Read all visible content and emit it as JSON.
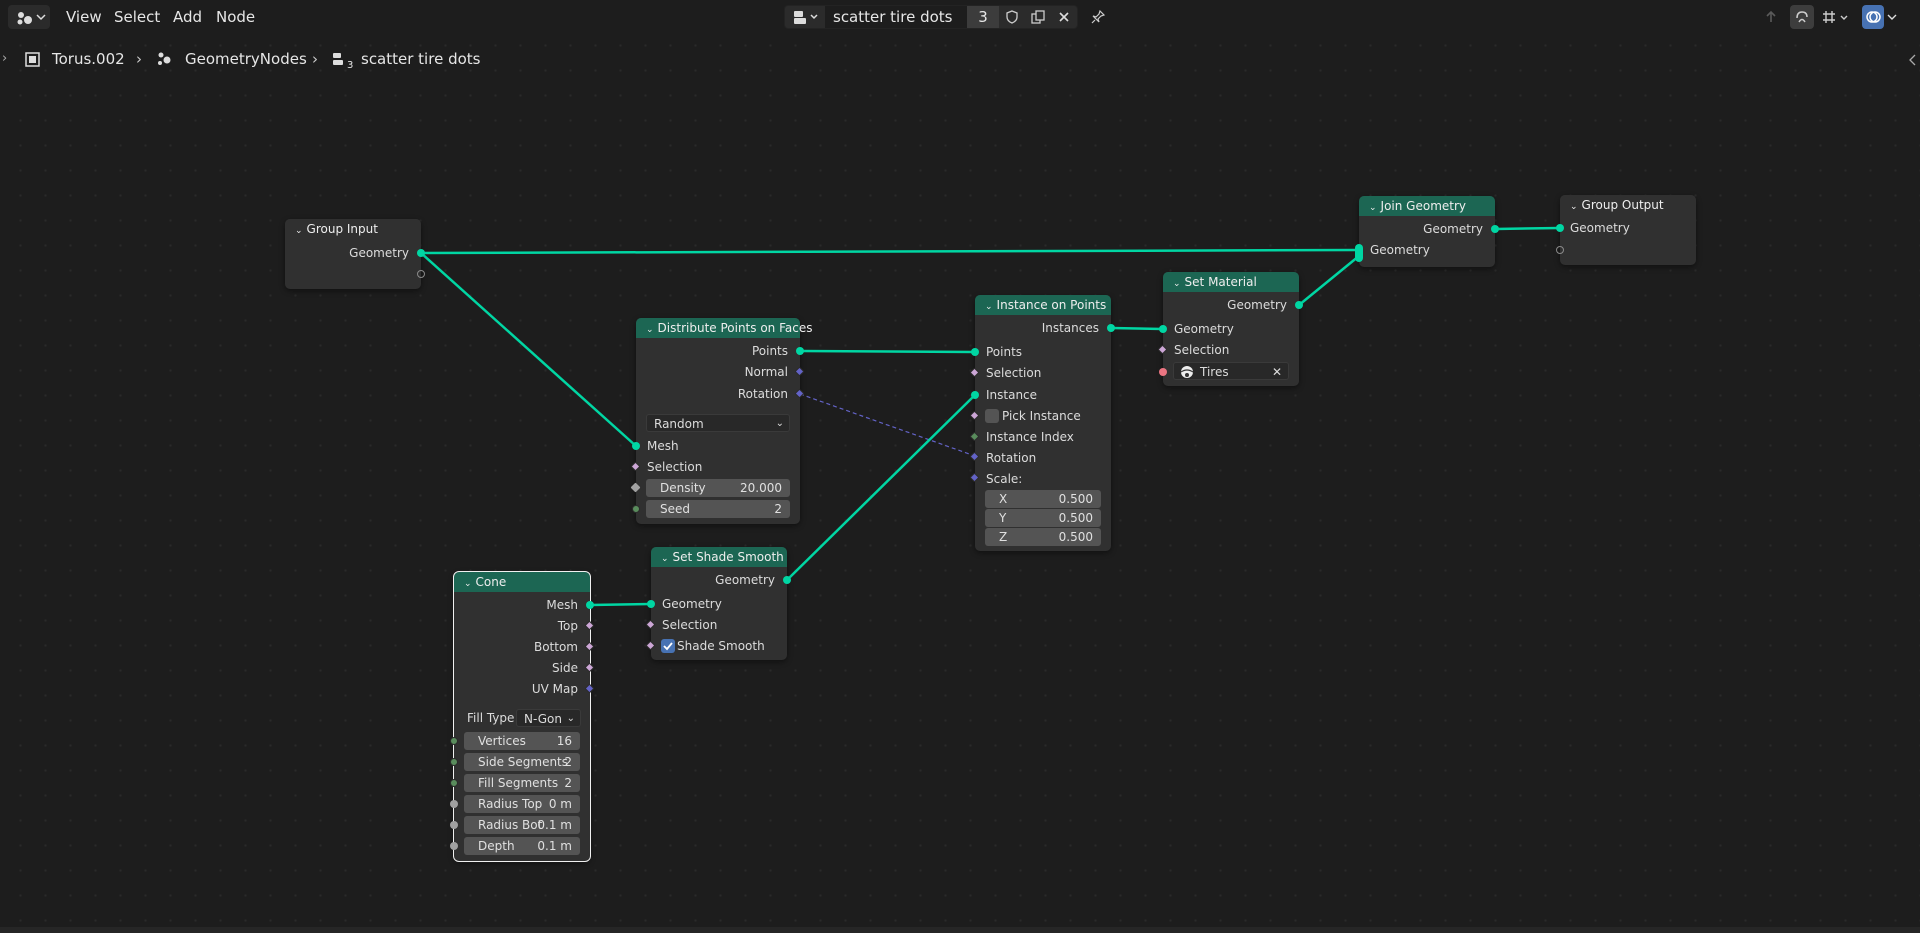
{
  "header": {
    "menus": [
      "View",
      "Select",
      "Add",
      "Node"
    ],
    "node_tree": {
      "name": "scatter tire dots",
      "users": "3"
    }
  },
  "breadcrumb": {
    "object": "Torus.002",
    "modifier": "GeometryNodes",
    "tree": "scatter tire dots",
    "tree_users": "3"
  },
  "colors": {
    "geometry_socket": "#00d6a3",
    "geometry_header": "#1c6653",
    "link": "#00d6a3",
    "vector_link": "#6363c7",
    "selection_accent": "#4772b3"
  },
  "nodes": {
    "group_input": {
      "title": "Group Input",
      "out_geometry": "Geometry"
    },
    "group_output": {
      "title": "Group Output",
      "in_geometry": "Geometry"
    },
    "join_geometry": {
      "title": "Join Geometry",
      "out_geometry": "Geometry",
      "in_geometry": "Geometry"
    },
    "set_material": {
      "title": "Set Material",
      "out_geometry": "Geometry",
      "in_geometry": "Geometry",
      "in_selection": "Selection",
      "material": "Tires"
    },
    "instance_on_points": {
      "title": "Instance on Points",
      "out_instances": "Instances",
      "in_points": "Points",
      "in_selection": "Selection",
      "in_instance": "Instance",
      "pick_instance": "Pick Instance",
      "instance_index": "Instance Index",
      "rotation": "Rotation",
      "scale_label": "Scale:",
      "scale": [
        {
          "axis": "X",
          "value": "0.500"
        },
        {
          "axis": "Y",
          "value": "0.500"
        },
        {
          "axis": "Z",
          "value": "0.500"
        }
      ]
    },
    "distribute": {
      "title": "Distribute Points on Faces",
      "out_points": "Points",
      "out_normal": "Normal",
      "out_rotation": "Rotation",
      "mode": "Random",
      "in_mesh": "Mesh",
      "in_selection": "Selection",
      "density_label": "Density",
      "density": "20.000",
      "seed_label": "Seed",
      "seed": "2"
    },
    "set_shade_smooth": {
      "title": "Set Shade Smooth",
      "out_geometry": "Geometry",
      "in_geometry": "Geometry",
      "in_selection": "Selection",
      "shade_smooth": "Shade Smooth",
      "shade_smooth_checked": true
    },
    "cone": {
      "title": "Cone",
      "out_mesh": "Mesh",
      "out_top": "Top",
      "out_bottom": "Bottom",
      "out_side": "Side",
      "out_uvmap": "UV Map",
      "fill_type_label": "Fill Type",
      "fill_type": "N-Gon",
      "fields": [
        {
          "label": "Vertices",
          "value": "16"
        },
        {
          "label": "Side Segments",
          "value": "2"
        },
        {
          "label": "Fill Segments",
          "value": "2"
        },
        {
          "label": "Radius Top",
          "value": "0 m"
        },
        {
          "label": "Radius Bot",
          "value": "0.1 m"
        },
        {
          "label": "Depth",
          "value": "0.1 m"
        }
      ]
    }
  }
}
